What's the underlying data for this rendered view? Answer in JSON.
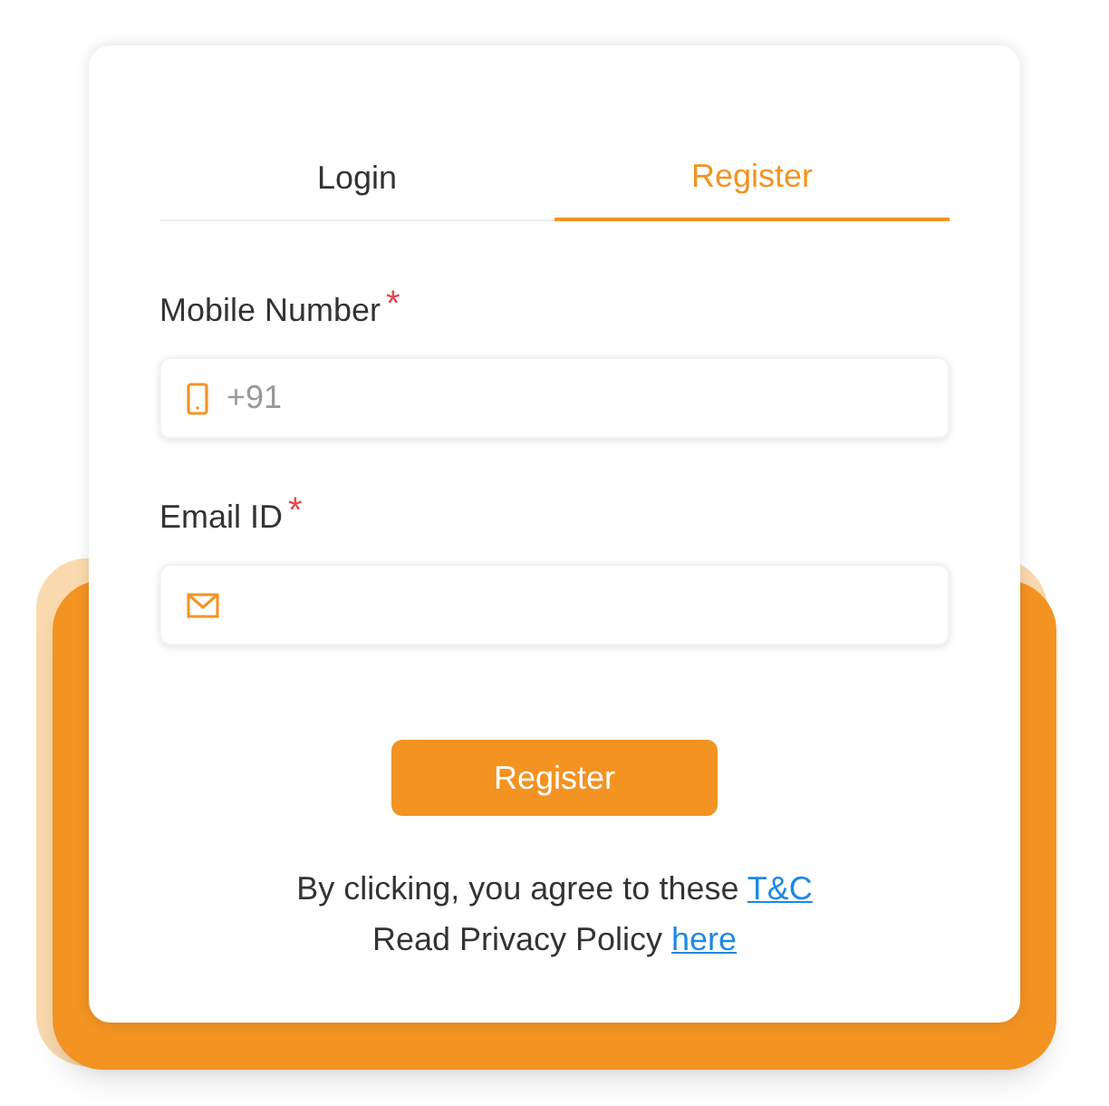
{
  "tabs": [
    {
      "label": "Login",
      "selected": false
    },
    {
      "label": "Register",
      "selected": true
    }
  ],
  "fields": [
    {
      "kind": "phone",
      "label": "Mobile Number",
      "required_mark": "*",
      "placeholder": "+91"
    },
    {
      "kind": "email",
      "label": "Email ID",
      "required_mark": "*"
    }
  ],
  "submit_button": "Register",
  "footer_lines": [
    {
      "text": "By clicking, you agree to these",
      "link": "T&C"
    },
    {
      "text": "Read Privacy Policy",
      "link": "here"
    }
  ]
}
